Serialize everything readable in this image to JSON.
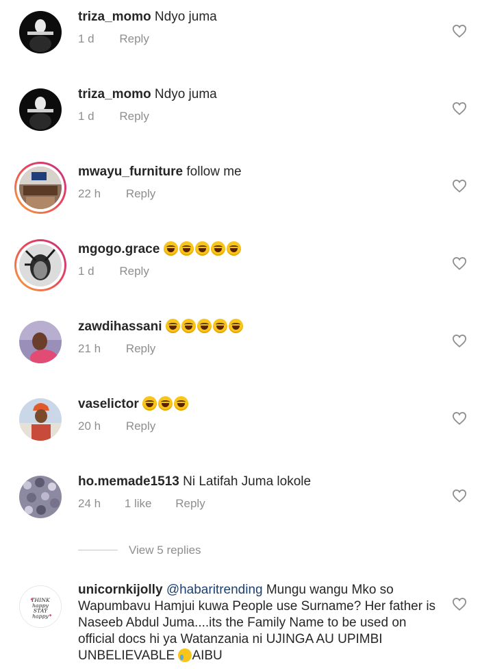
{
  "comments": [
    {
      "username": "triza_momo",
      "text": "Ndyo juma",
      "time": "1 d",
      "likes": "",
      "reply": "Reply",
      "emojis": 0
    },
    {
      "username": "triza_momo",
      "text": "Ndyo juma",
      "time": "1 d",
      "likes": "",
      "reply": "Reply",
      "emojis": 0
    },
    {
      "username": "mwayu_furniture",
      "text": "follow me",
      "time": "22 h",
      "likes": "",
      "reply": "Reply",
      "emojis": 0
    },
    {
      "username": "mgogo.grace",
      "text": "",
      "time": "1 d",
      "likes": "",
      "reply": "Reply",
      "emojis": 5
    },
    {
      "username": "zawdihassani",
      "text": "",
      "time": "21 h",
      "likes": "",
      "reply": "Reply",
      "emojis": 5
    },
    {
      "username": "vaselictor",
      "text": "",
      "time": "20 h",
      "likes": "",
      "reply": "Reply",
      "emojis": 3
    },
    {
      "username": "ho.memade1513",
      "text": "Ni Latifah Juma lokole",
      "time": "24 h",
      "likes": "1 like",
      "reply": "Reply",
      "emojis": 0
    }
  ],
  "view_replies": "View 5 replies",
  "last_comment": {
    "username": "unicornkijolly",
    "mention": "@habaritrending",
    "text": " Mungu wangu Mko so Wapumbavu  Hamjui kuwa People use Surname? Her father  is Naseeb Abdul  Juma....its the Family  Name to be used on official  docs  hi ya Watanzania  ni UJINGA AU UPIMBI  UNBELIEVABLE ",
    "text_end": "AIBU",
    "avatar_text": "THINK happy STAY happy"
  },
  "colors": {
    "text": "#262626",
    "meta": "#8e8e8e",
    "mention": "#1c3f6e",
    "ring_start": "#f9a43c",
    "ring_end": "#c13584"
  }
}
